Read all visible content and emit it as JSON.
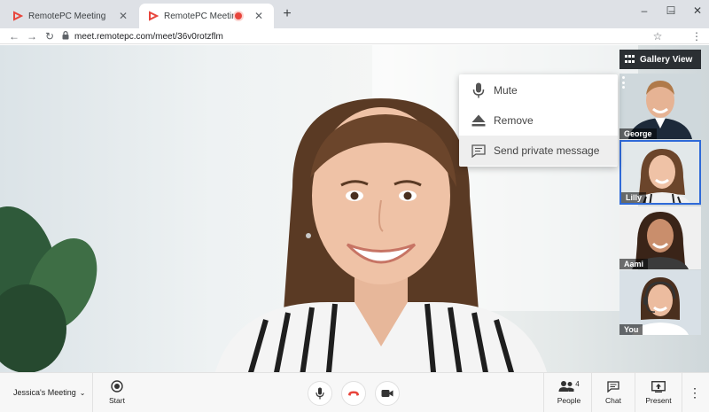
{
  "browser": {
    "tabs": [
      {
        "title": "RemotePC Meeting",
        "close": "✕"
      },
      {
        "title": "RemotePC Meeting",
        "close": "✕"
      }
    ],
    "new_tab": "+",
    "window_controls": {
      "minimize": "–",
      "maximize": "☐",
      "close": "✕"
    },
    "url": "meet.remotepc.com/meet/36v0rotzflm"
  },
  "gallery_view_label": "Gallery View",
  "participants": [
    {
      "name": "George"
    },
    {
      "name": "Lilly"
    },
    {
      "name": "Aami"
    },
    {
      "name": "You"
    }
  ],
  "context_menu": {
    "items": [
      {
        "label": "Mute",
        "icon": "microphone-icon"
      },
      {
        "label": "Remove",
        "icon": "eject-icon"
      },
      {
        "label": "Send private message",
        "icon": "chat-icon"
      }
    ]
  },
  "toolbar": {
    "meeting_name": "Jessica's Meeting",
    "start_label": "Start",
    "people_label": "People",
    "people_count": "4",
    "chat_label": "Chat",
    "present_label": "Present"
  },
  "colors": {
    "accent_red": "#e8453c",
    "selected_border": "#2f6ad8",
    "gallery_button_bg": "#2b2f33"
  }
}
